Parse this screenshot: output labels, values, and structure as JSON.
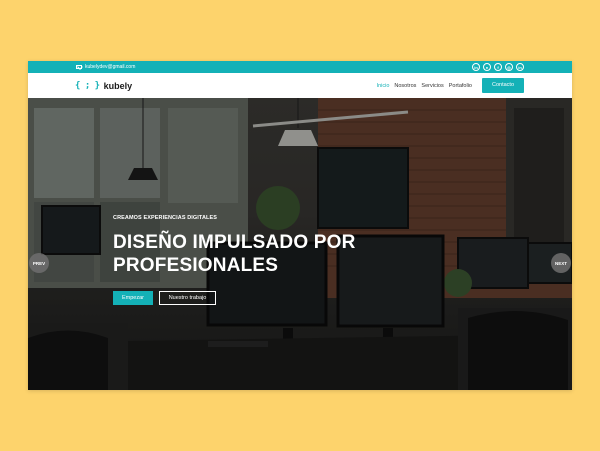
{
  "topbar": {
    "email": "kubelydev@gmail.com",
    "socials": [
      "in",
      "gh",
      "f",
      "ig",
      "in"
    ]
  },
  "brand": {
    "mark": "{ ; }",
    "name": "kubely"
  },
  "nav": {
    "items": [
      "Inicio",
      "Nosotros",
      "Servicios",
      "Portafolio"
    ],
    "active": "Inicio",
    "contact": "Contacto"
  },
  "hero": {
    "eyebrow": "CREAMOS EXPERIENCIAS DIGITALES",
    "line1": "DISEÑO IMPULSADO POR",
    "line2": "PROFESIONALES",
    "primary_cta": "Empezar",
    "secondary_cta": "Nuestro trabajo",
    "prev": "PREV",
    "next": "NEXT"
  },
  "colors": {
    "accent": "#14b1b7",
    "background": "#fdd36c"
  }
}
